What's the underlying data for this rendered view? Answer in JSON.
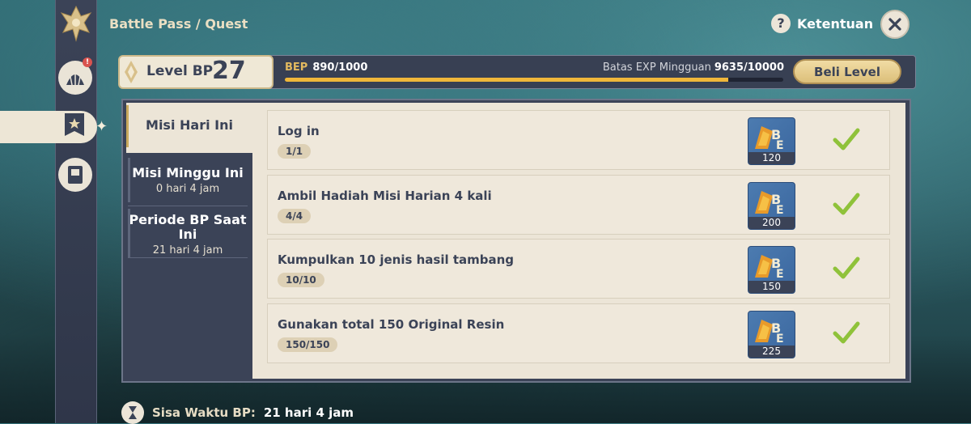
{
  "header": {
    "breadcrumb": "Battle Pass / Quest",
    "help_label": "Ketentuan"
  },
  "level": {
    "label": "Level BP",
    "value": "27",
    "bep_label": "BEP",
    "bep_value": "890/1000",
    "bep_progress": 0.89,
    "weekly_label": "Batas EXP Mingguan",
    "weekly_value": "9635/10000",
    "buy_label": "Beli Level"
  },
  "tabs": [
    {
      "title": "Misi Hari Ini",
      "subtitle": ""
    },
    {
      "title": "Misi Minggu Ini",
      "subtitle": "0 hari 4 jam"
    },
    {
      "title": "Periode BP Saat Ini",
      "subtitle": "21 hari 4 jam"
    }
  ],
  "quests": [
    {
      "name": "Log in",
      "progress": "1/1",
      "reward_qty": "120",
      "reward_icon": "bp-exp-icon",
      "completed": true
    },
    {
      "name": "Ambil Hadiah Misi Harian 4 kali",
      "progress": "4/4",
      "reward_qty": "200",
      "reward_icon": "bp-exp-icon",
      "completed": true
    },
    {
      "name": "Kumpulkan 10 jenis hasil tambang",
      "progress": "10/10",
      "reward_qty": "150",
      "reward_icon": "bp-exp-icon",
      "completed": true
    },
    {
      "name": "Gunakan total 150 Original Resin",
      "progress": "150/150",
      "reward_qty": "225",
      "reward_icon": "bp-exp-icon",
      "completed": true
    }
  ],
  "footer": {
    "label": "Sisa Waktu BP:",
    "value": "21 hari 4 jam"
  },
  "colors": {
    "accent": "#f0b73a",
    "panel": "#3b4357",
    "paper": "#ece5d7",
    "check": "#8fc23a"
  }
}
